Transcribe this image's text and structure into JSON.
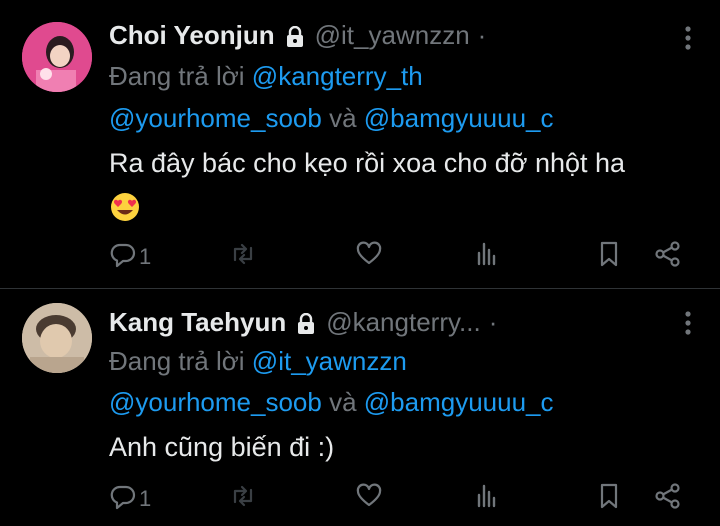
{
  "replies": [
    {
      "name": "Choi Yeonjun",
      "handle": "@it_yawnzzn",
      "dot": "·",
      "replying_prefix": "Đang trả lời",
      "replying_to_first": "@kangterry_th",
      "replying_to_second": "@yourhome_soob",
      "replying_joiner": " và ",
      "replying_to_third": "@bamgyuuuu_c",
      "text": "Ra đây bác cho kẹo rồi xoa cho đỡ nhột ha",
      "emoji": "😍",
      "reply_count": "1",
      "icons": [
        "lock-icon",
        "more-icon",
        "reply-icon",
        "retweet-icon",
        "like-icon",
        "views-icon",
        "bookmark-icon",
        "share-icon"
      ]
    },
    {
      "name": "Kang Taehyun",
      "handle": "@kangterry...",
      "dot": "·",
      "replying_prefix": "Đang trả lời",
      "replying_to_first": "@it_yawnzzn",
      "replying_to_second": "@yourhome_soob",
      "replying_joiner": " và ",
      "replying_to_third": "@bamgyuuuu_c",
      "text": "Anh cũng biến đi :)",
      "reply_count": "1"
    }
  ],
  "colors": {
    "background": "#000000",
    "primary_text": "#e7e9ea",
    "secondary_text": "#71767b",
    "mention": "#1d9bf0",
    "divider": "#2f3336"
  }
}
